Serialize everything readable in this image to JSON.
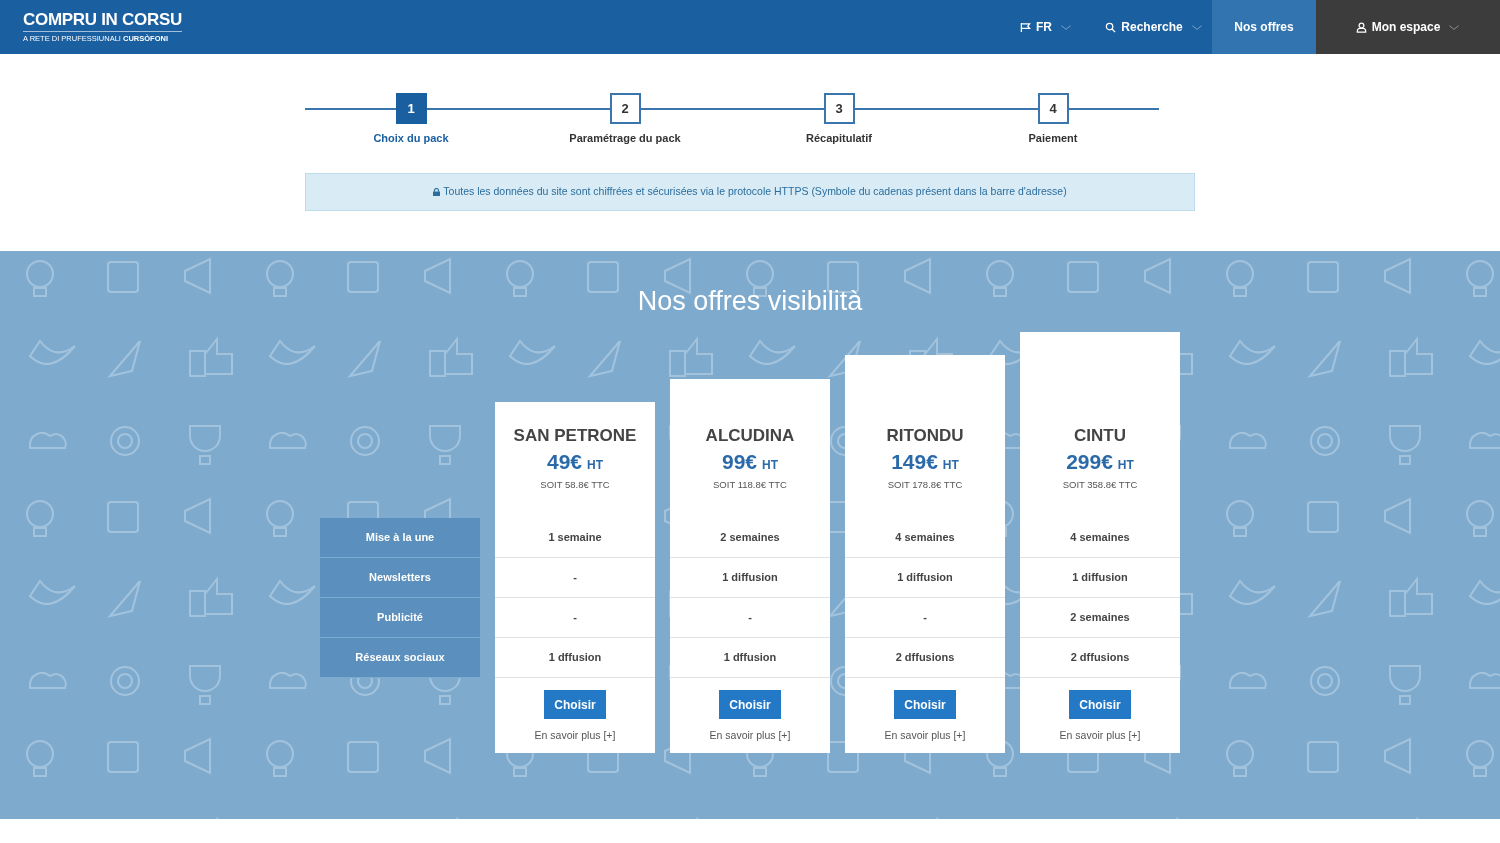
{
  "logo": {
    "title": "COMPRU IN CORSU",
    "tagline": "A RETE DI PRUFESSIUNALI **CURSÒFONI**"
  },
  "nav": [
    {
      "kind": "language",
      "label": "FR",
      "dropdown": true,
      "selected": false
    },
    {
      "kind": "search",
      "label": "Recherche",
      "dropdown": true,
      "selected": false
    },
    {
      "kind": "link",
      "label": "Nos offres",
      "dropdown": false,
      "selected": true
    },
    {
      "kind": "account",
      "label": "Mon espace",
      "dropdown": true,
      "selected": false
    }
  ],
  "steps": [
    {
      "number": "1",
      "label": "Choix du pack",
      "selected": true
    },
    {
      "number": "2",
      "label": "Paramétrage du pack",
      "selected": false
    },
    {
      "number": "3",
      "label": "Récapitulatif",
      "selected": false
    },
    {
      "number": "4",
      "label": "Paiement",
      "selected": false
    }
  ],
  "notice": "Toutes les données du site sont chiffrées et sécurisées via le protocole HTTPS (Symbole du cadenas présent dans la barre d'adresse)",
  "offers": {
    "title": "Nos offres visibilità",
    "features": [
      "Mise à la une",
      "Newsletters",
      "Publicité",
      "Réseaux sociaux"
    ],
    "plans": [
      {
        "name": "SAN PETRONE",
        "price": "49€",
        "unit": "HT",
        "ttc": "SOIT 58.8€ TTC",
        "values": [
          "1 semaine",
          "-",
          "-",
          "1 dffusion"
        ],
        "button": "Choisir",
        "more": "En savoir plus [+]"
      },
      {
        "name": "ALCUDINA",
        "price": "99€",
        "unit": "HT",
        "ttc": "SOIT 118.8€ TTC",
        "values": [
          "2 semaines",
          "1 diffusion",
          "-",
          "1 dffusion"
        ],
        "button": "Choisir",
        "more": "En savoir plus [+]"
      },
      {
        "name": "RITONDU",
        "price": "149€",
        "unit": "HT",
        "ttc": "SOIT 178.8€ TTC",
        "values": [
          "4 semaines",
          "1 diffusion",
          "-",
          "2 dffusions"
        ],
        "button": "Choisir",
        "more": "En savoir plus [+]"
      },
      {
        "name": "CINTU",
        "price": "299€",
        "unit": "HT",
        "ttc": "SOIT 358.8€ TTC",
        "values": [
          "4 semaines",
          "1 diffusion",
          "2 semaines",
          "2 dffusions"
        ],
        "button": "Choisir",
        "more": "En savoir plus [+]"
      }
    ]
  }
}
